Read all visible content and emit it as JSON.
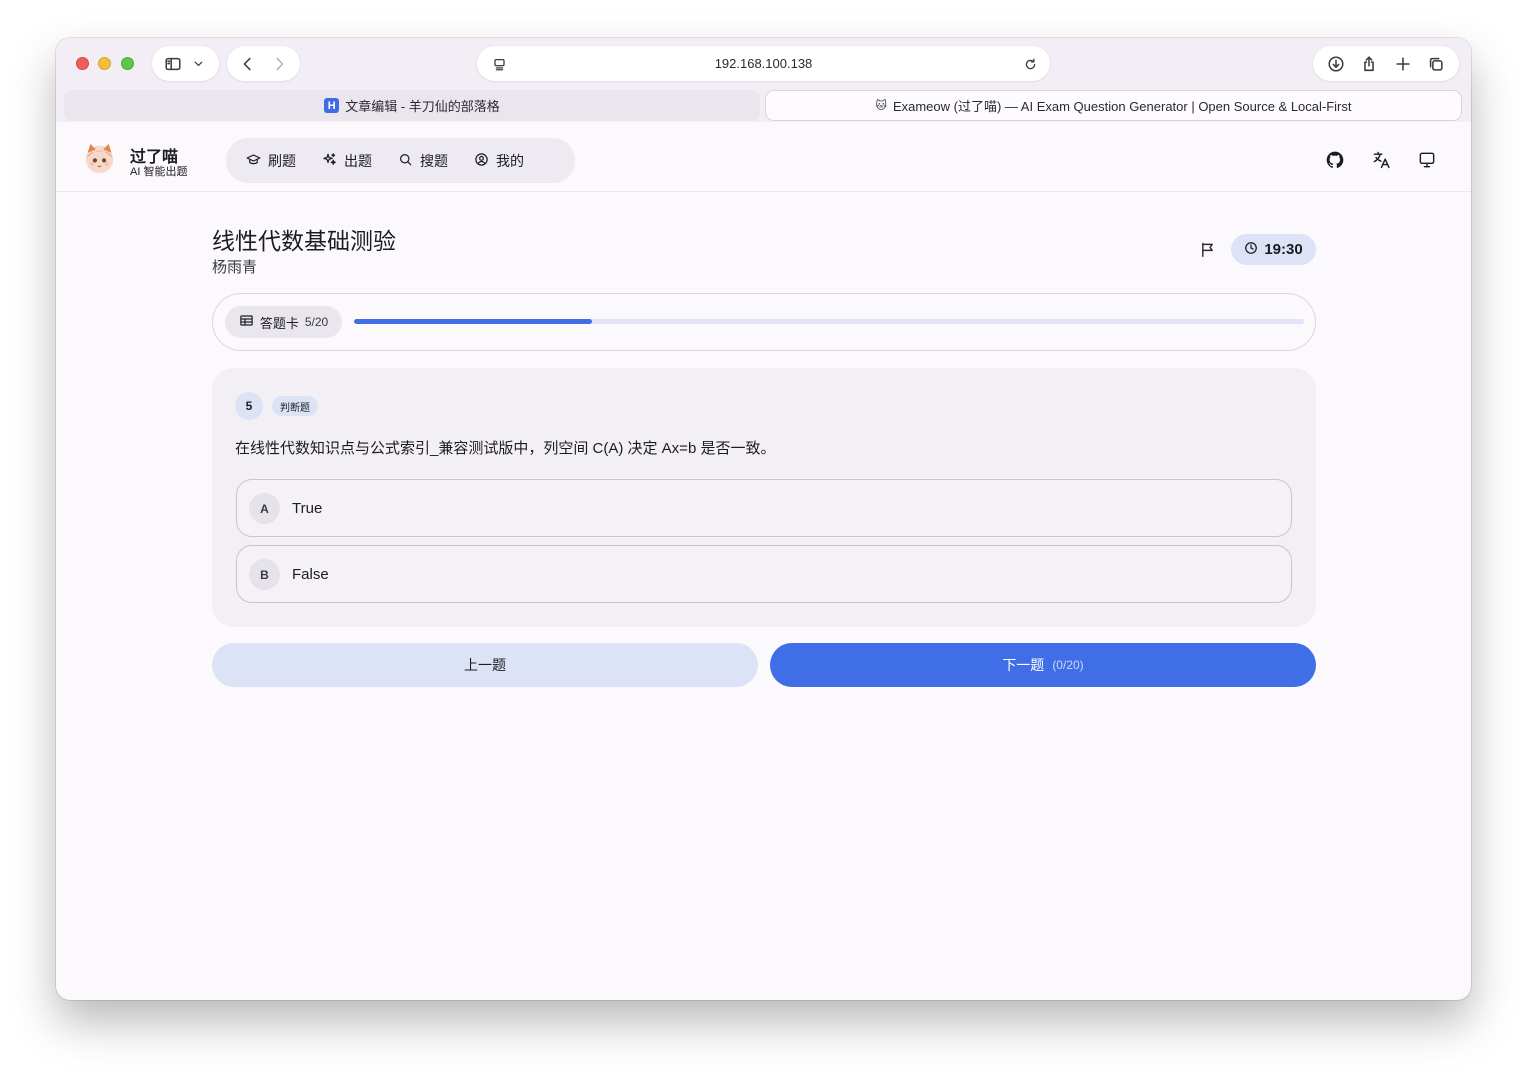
{
  "browser": {
    "url": "192.168.100.138",
    "tabs": [
      {
        "title": "文章编辑 - 羊刀仙的部落格",
        "favicon": "H"
      },
      {
        "title": "Exameow (过了喵) — AI Exam Question Generator | Open Source & Local-First",
        "favicon": "cat-icon"
      }
    ]
  },
  "app": {
    "brand": {
      "name": "过了喵",
      "subtitle": "AI 智能出题"
    },
    "nav": [
      {
        "label": "刷题",
        "icon": "graduation-cap-icon"
      },
      {
        "label": "出题",
        "icon": "sparkles-icon"
      },
      {
        "label": "搜题",
        "icon": "search-icon"
      },
      {
        "label": "我的",
        "icon": "user-circle-icon"
      }
    ],
    "header_actions": [
      "github-icon",
      "translate-icon",
      "display-icon"
    ]
  },
  "exam": {
    "title": "线性代数基础测验",
    "author": "杨雨青",
    "timer": "19:30",
    "answer_card": {
      "label": "答题卡",
      "count": "5/20"
    },
    "progress": 0.25,
    "question": {
      "number": "5",
      "type": "判断题",
      "text": "在线性代数知识点与公式索引_兼容测试版中，列空间 C(A) 决定 Ax=b 是否一致。",
      "options": [
        {
          "letter": "A",
          "text": "True"
        },
        {
          "letter": "B",
          "text": "False"
        }
      ]
    },
    "prev_label": "上一题",
    "next_label": "下一题",
    "next_count": "(0/20)"
  },
  "colors": {
    "accent": "#3f6ee6",
    "accent_soft": "#dde3f7",
    "window_bg": "#fcf9fd"
  }
}
